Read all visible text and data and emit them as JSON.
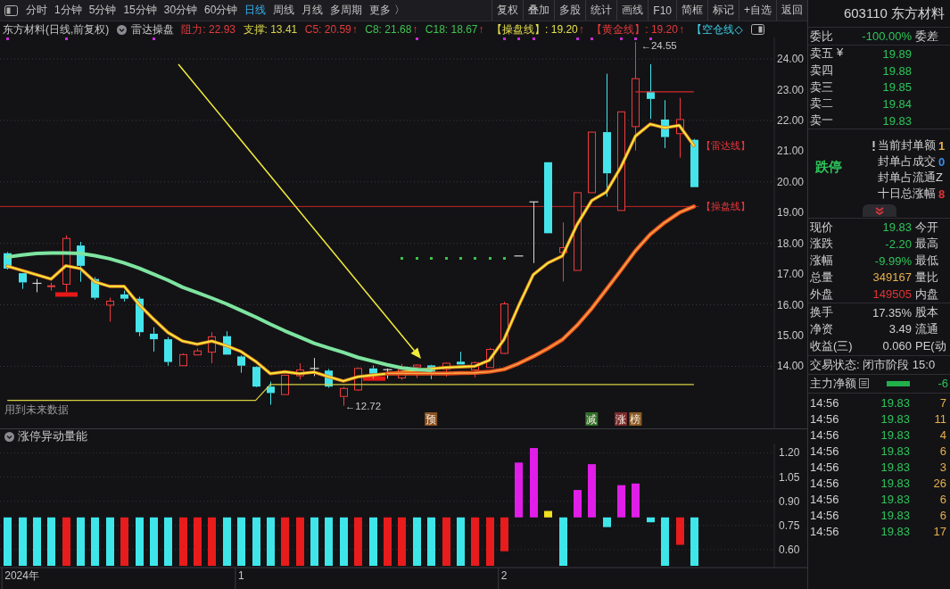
{
  "toolbar": {
    "period_tabs": [
      {
        "label": "分时",
        "selected": false
      },
      {
        "label": "1分钟",
        "selected": false
      },
      {
        "label": "5分钟",
        "selected": false
      },
      {
        "label": "15分钟",
        "selected": false
      },
      {
        "label": "30分钟",
        "selected": false
      },
      {
        "label": "60分钟",
        "selected": false
      },
      {
        "label": "日线",
        "selected": true
      },
      {
        "label": "周线",
        "selected": false
      },
      {
        "label": "月线",
        "selected": false
      },
      {
        "label": "多周期",
        "selected": false
      },
      {
        "label": "更多 〉",
        "selected": false
      }
    ],
    "actions": [
      "复权",
      "叠加",
      "多股",
      "统计",
      "画线",
      "F10",
      "简框",
      "标记",
      "+自选",
      "返回"
    ]
  },
  "indicator_bar": {
    "title": "东方材料(日线,前复权)",
    "indicator": "雷达操盘",
    "values": [
      {
        "label": "阻力: 22.93",
        "color": "#e33b3b"
      },
      {
        "label": "支撑: 13.41",
        "color": "#d9d44a"
      },
      {
        "label": "C5: 20.59",
        "color": "#e33b3b",
        "arrow": "↑"
      },
      {
        "label": "C8: 21.68",
        "color": "#3fc24f",
        "arrow": "↑"
      },
      {
        "label": "C18: 18.67",
        "color": "#3fc24f",
        "arrow": "↑"
      },
      {
        "label": "【操盘线】: 19.20",
        "color": "#e6e04a",
        "arrow": "↑"
      },
      {
        "label": "【黄金线】: 19.20",
        "color": "#e33b3b",
        "arrow": "↑"
      },
      {
        "label": "【空仓线◇",
        "color": "#3ccfe6"
      }
    ]
  },
  "main_chart": {
    "chart_data": {
      "type": "candlestick",
      "categories": [
        null,
        null,
        null,
        null,
        null,
        null,
        null,
        null,
        null,
        null,
        null,
        null,
        null,
        null,
        null,
        null,
        null,
        null,
        null,
        null,
        null,
        null,
        null,
        null,
        null,
        null,
        null,
        null,
        null,
        null,
        null,
        null,
        null,
        null,
        null,
        null,
        null,
        null,
        null,
        null,
        null,
        null,
        null,
        null,
        null,
        null,
        null,
        null
      ],
      "ylim": [
        11.98,
        24.7
      ],
      "yticks": [
        {
          "value": 14,
          "label": "14.00"
        },
        {
          "value": 15,
          "label": "15.00"
        },
        {
          "value": 16,
          "label": "16.00"
        },
        {
          "value": 17,
          "label": "17.00"
        },
        {
          "value": 18,
          "label": "18.00"
        },
        {
          "value": 19,
          "label": "19.00"
        },
        {
          "value": 20,
          "label": "20.00"
        },
        {
          "value": 21,
          "label": "21.00"
        },
        {
          "value": 22,
          "label": "22.00"
        },
        {
          "value": 23,
          "label": "23.00"
        },
        {
          "value": 24,
          "label": "24.00"
        }
      ],
      "grid": true,
      "ohlc": [
        [
          17.68,
          17.72,
          17.15,
          17.18
        ],
        [
          17.03,
          17.03,
          16.52,
          16.73
        ],
        [
          16.7,
          16.84,
          16.41,
          16.7
        ],
        [
          16.6,
          16.72,
          16.46,
          16.62
        ],
        [
          16.67,
          18.26,
          16.41,
          18.16
        ],
        [
          17.93,
          18.05,
          16.75,
          17.27
        ],
        [
          16.84,
          16.9,
          16.17,
          16.23
        ],
        [
          15.99,
          16.23,
          15.45,
          16.12
        ],
        [
          16.34,
          16.46,
          16.11,
          16.2
        ],
        [
          16.2,
          16.26,
          14.98,
          15.11
        ],
        [
          15.06,
          15.27,
          14.48,
          14.88
        ],
        [
          14.88,
          14.95,
          14.02,
          14.14
        ],
        [
          14.02,
          14.42,
          14.02,
          14.38
        ],
        [
          14.37,
          14.58,
          14.37,
          14.5
        ],
        [
          14.46,
          15.11,
          14.1,
          14.96
        ],
        [
          14.98,
          15.14,
          14.38,
          14.38
        ],
        [
          14.32,
          14.36,
          13.79,
          14.02
        ],
        [
          13.98,
          14,
          13.32,
          13.34
        ],
        [
          13.34,
          13.5,
          12.75,
          13.13
        ],
        [
          13.08,
          13.71,
          13.08,
          13.71
        ],
        [
          13.69,
          14.1,
          13.57,
          13.88
        ],
        [
          13.93,
          14.27,
          13.68,
          13.93
        ],
        [
          13.86,
          13.91,
          13.3,
          13.34
        ],
        [
          13.02,
          13.33,
          12.72,
          13.28
        ],
        [
          13.23,
          13.96,
          13.2,
          13.93
        ],
        [
          13.93,
          14.03,
          13.6,
          13.76
        ],
        [
          13.89,
          13.93,
          13.6,
          13.89
        ],
        [
          13.62,
          14.08,
          13.56,
          13.9
        ],
        [
          13.98,
          14.06,
          13.62,
          14.04
        ],
        [
          14.03,
          14.05,
          13.58,
          13.82
        ],
        [
          13.9,
          14.12,
          13.66,
          14.1
        ],
        [
          14.15,
          14.47,
          14.06,
          14.06
        ],
        [
          13.88,
          14.15,
          13.64,
          14.12
        ],
        [
          13.96,
          14.6,
          13.96,
          14.55
        ],
        [
          14.42,
          16.1,
          14.4,
          16.03
        ],
        [
          17.59,
          17.59,
          17.59,
          17.59
        ],
        [
          19.35,
          19.35,
          17.36,
          19.35
        ],
        [
          20.64,
          20.64,
          18.33,
          18.33
        ],
        [
          17.7,
          18.68,
          16.76,
          17.86
        ],
        [
          17.12,
          19.65,
          17.12,
          19.65
        ],
        [
          19.65,
          21.62,
          19.65,
          21.62
        ],
        [
          21.62,
          23.52,
          19.52,
          20.28
        ],
        [
          19.07,
          22.28,
          19.07,
          22.28
        ],
        [
          21.8,
          24.55,
          21.02,
          23.36
        ],
        [
          22.94,
          23.83,
          22.05,
          22.7
        ],
        [
          22.03,
          22.66,
          21.1,
          21.46
        ],
        [
          21.57,
          22.74,
          20.79,
          22.03
        ],
        [
          21.37,
          21.4,
          19.83,
          19.83
        ]
      ],
      "series": [
        {
          "name": "【雷达线】",
          "type": "line",
          "color": "#f4ec3c",
          "values": [
            17.26,
            17.12,
            16.98,
            16.84,
            17.27,
            17.18,
            16.75,
            16.6,
            16.6,
            16.02,
            15.54,
            15.1,
            14.82,
            14.72,
            14.82,
            14.67,
            14.48,
            14.16,
            13.76,
            13.82,
            13.76,
            13.81,
            13.66,
            13.52,
            13.66,
            13.71,
            13.76,
            13.81,
            13.86,
            13.92,
            13.96,
            13.98,
            14,
            14.2,
            14.87,
            15.97,
            16.98,
            17.36,
            17.59,
            18.61,
            19.39,
            19.67,
            20.48,
            21.49,
            21.88,
            21.76,
            21.84,
            21.18
          ]
        },
        {
          "name": "【操盘线】",
          "type": "line",
          "color": "#e8501e",
          "values": [
            null,
            null,
            null,
            null,
            null,
            null,
            null,
            null,
            null,
            null,
            null,
            null,
            null,
            null,
            null,
            null,
            null,
            null,
            null,
            null,
            null,
            null,
            null,
            null,
            null,
            null,
            13.77,
            13.77,
            13.77,
            13.77,
            13.77,
            13.78,
            13.79,
            13.82,
            13.9,
            14.09,
            14.32,
            14.58,
            14.87,
            15.33,
            15.88,
            16.5,
            17.12,
            17.76,
            18.29,
            18.68,
            19,
            19.2
          ]
        },
        {
          "type": "line",
          "color": "#7ee4a0",
          "values": [
            17.56,
            17.62,
            17.67,
            17.69,
            17.69,
            17.67,
            17.6,
            17.5,
            17.36,
            17.2,
            17,
            16.8,
            16.57,
            16.4,
            16.22,
            16.03,
            15.82,
            15.6,
            15.37,
            15.15,
            14.95,
            14.75,
            14.6,
            14.45,
            14.29,
            14.17,
            14.05,
            13.95,
            13.9,
            13.87,
            null,
            null,
            null,
            null,
            null,
            null,
            null,
            null,
            null,
            null,
            null,
            null,
            null,
            null,
            null,
            null,
            null,
            null
          ]
        },
        {
          "type": "line",
          "color": "#d8d040",
          "values": [
            12.89,
            12.89,
            12.89,
            12.89,
            12.89,
            12.89,
            12.89,
            12.89,
            12.89,
            12.89,
            12.89,
            12.89,
            12.89,
            12.89,
            12.89,
            12.89,
            12.89,
            12.89,
            13.41,
            13.41,
            13.41,
            13.41,
            13.41,
            13.41,
            13.41,
            13.41,
            13.41,
            13.41,
            13.41,
            13.41,
            13.41,
            13.41,
            13.41,
            13.41,
            13.41,
            13.41,
            13.41,
            13.41,
            13.41,
            13.41,
            13.41,
            13.41,
            13.41,
            13.41,
            13.41,
            13.41,
            13.41,
            13.41
          ]
        },
        {
          "type": "line",
          "color": "#d42a2a",
          "values": [
            null,
            null,
            null,
            null,
            null,
            null,
            null,
            null,
            null,
            null,
            null,
            null,
            null,
            null,
            null,
            null,
            null,
            null,
            null,
            null,
            null,
            null,
            null,
            null,
            null,
            null,
            null,
            null,
            null,
            null,
            null,
            null,
            null,
            null,
            null,
            null,
            null,
            null,
            null,
            null,
            null,
            null,
            null,
            22.93,
            22.93,
            22.93,
            22.93,
            22.93
          ]
        },
        {
          "type": "scatter",
          "marker": "square",
          "color": "#c42ed4",
          "values": [
            24.66,
            null,
            null,
            null,
            24.66,
            null,
            null,
            null,
            null,
            null,
            24.66,
            null,
            null,
            null,
            null,
            null,
            null,
            null,
            null,
            null,
            null,
            null,
            null,
            null,
            null,
            null,
            null,
            null,
            24.66,
            null,
            null,
            null,
            null,
            null,
            24.66,
            24.66,
            24.66,
            null,
            null,
            24.66,
            24.66,
            null,
            24.66,
            24.66,
            24.66,
            null,
            null,
            null
          ]
        },
        {
          "type": "scatter",
          "marker": "square",
          "color": "#3cc24c",
          "values": [
            null,
            null,
            null,
            null,
            null,
            null,
            null,
            null,
            null,
            null,
            null,
            null,
            null,
            null,
            null,
            null,
            null,
            null,
            null,
            null,
            null,
            null,
            null,
            null,
            null,
            null,
            null,
            17.53,
            17.53,
            17.53,
            17.53,
            17.53,
            17.53,
            17.53,
            17.53,
            null,
            null,
            null,
            null,
            null,
            null,
            null,
            null,
            null,
            null,
            null,
            null,
            null
          ]
        }
      ],
      "ref_lines": [
        {
          "axis": "y",
          "value": 19.2,
          "color": "#c42626"
        }
      ],
      "annotations": [
        "←24.55",
        "←12.72"
      ]
    },
    "notice": "用到未来数据",
    "signals": [
      {
        "label": "预",
        "color": "#8a4f1e"
      },
      {
        "label": "减",
        "color": "#2f6e2a"
      },
      {
        "label": "涨",
        "color": "#7c2a2c"
      },
      {
        "label": "榜",
        "color": "#8a5a24"
      }
    ]
  },
  "sub_chart": {
    "title": "涨停异动量能",
    "chart_data": {
      "type": "bar",
      "categories": [
        null,
        "2024年",
        null,
        null,
        null,
        null,
        null,
        null,
        null,
        null,
        null,
        null,
        null,
        null,
        null,
        null,
        "1",
        null,
        null,
        null,
        null,
        null,
        null,
        null,
        null,
        null,
        null,
        null,
        null,
        null,
        null,
        null,
        null,
        null,
        "2",
        null,
        null,
        null,
        null,
        null,
        null,
        null,
        null,
        null,
        null,
        null,
        null,
        null,
        null,
        null,
        null,
        null,
        null
      ],
      "base": [
        0.8,
        0.8,
        0.8,
        0.8,
        0.8,
        0.8,
        0.8,
        0.8,
        0.8,
        0.8,
        0.8,
        0.8,
        0.8,
        0.8,
        0.8,
        0.8,
        0.8,
        0.8,
        0.8,
        0.8,
        0.8,
        0.8,
        0.8,
        0.8,
        0.8,
        0.8,
        0.8,
        0.8,
        0.8,
        0.8,
        0.8,
        0.8,
        0.8,
        0.8,
        0.8,
        0.8,
        0.8,
        0.8,
        0.8,
        0.8,
        0.8,
        0.8,
        0.8,
        0.8,
        0.8,
        0.8,
        0.8,
        0.8,
        null,
        null,
        null,
        null,
        null
      ],
      "values": [
        -0.3,
        -0.3,
        -0.3,
        -0.3,
        -0.3,
        -0.3,
        -0.3,
        -0.3,
        -0.3,
        -0.3,
        -0.3,
        -0.3,
        -0.3,
        -0.3,
        -0.3,
        -0.3,
        -0.3,
        -0.3,
        -0.3,
        -0.3,
        -0.3,
        -0.3,
        -0.3,
        -0.3,
        -0.3,
        -0.3,
        -0.3,
        -0.3,
        -0.3,
        -0.3,
        -0.3,
        -0.3,
        -0.3,
        -0.3,
        -0.21,
        0.34,
        0.43,
        0.04,
        -0.3,
        0.17,
        0.33,
        -0.06,
        0.2,
        0.21,
        -0.03,
        -0.3,
        -0.17,
        -0.3,
        null,
        null,
        null,
        null,
        null
      ],
      "colors": [
        "#3ee6ea",
        "#3ee6ea",
        "#3ee6ea",
        "#3ee6ea",
        "#e81c1c",
        "#3ee6ea",
        "#3ee6ea",
        "#3ee6ea",
        "#e81c1c",
        "#3ee6ea",
        "#3ee6ea",
        "#3ee6ea",
        "#e81c1c",
        "#e81c1c",
        "#e81c1c",
        "#3ee6ea",
        "#3ee6ea",
        "#3ee6ea",
        "#3ee6ea",
        "#e81c1c",
        "#e81c1c",
        "#3ee6ea",
        "#3ee6ea",
        "#3ee6ea",
        "#e81c1c",
        "#3ee6ea",
        "#e81c1c",
        "#e81c1c",
        "#3ee6ea",
        "#3ee6ea",
        "#e81c1c",
        "#3ee6ea",
        "#e81c1c",
        "#e81c1c",
        "#e81c1c",
        "#e01ee8",
        "#e01ee8",
        "#f0e020",
        "#3ee6ea",
        "#e01ee8",
        "#e01ee8",
        "#3ee6ea",
        "#e01ee8",
        "#e01ee8",
        "#3ee6ea",
        "#3ee6ea",
        "#e81c1c",
        "#3ee6ea",
        null,
        null,
        null,
        null,
        null
      ],
      "ylim": [
        0.5,
        1.258
      ],
      "yticks": [
        {
          "value": 0.6,
          "label": "0.60"
        },
        {
          "value": 0.75,
          "label": "0.75"
        },
        {
          "value": 0.9,
          "label": "0.90"
        },
        {
          "value": 1.05,
          "label": "1.05"
        },
        {
          "value": 1.2,
          "label": "1.20"
        }
      ],
      "grid": true
    }
  },
  "quote_panel": {
    "title": "603110 东方材料",
    "order_ratio": {
      "label": "委比",
      "value": "-100.00%",
      "label2": "委差"
    },
    "asks": [
      {
        "label": "卖五",
        "tag": "¥",
        "price": "19.89"
      },
      {
        "label": "卖四",
        "price": "19.88"
      },
      {
        "label": "卖三",
        "price": "19.85"
      },
      {
        "label": "卖二",
        "price": "19.84"
      },
      {
        "label": "卖一",
        "price": "19.83"
      }
    ],
    "limit": {
      "status": "跌停",
      "metrics": [
        {
          "label": "当前封单额",
          "value": "1",
          "color": "#e8b04c",
          "alert": true
        },
        {
          "label": "封单占成交",
          "value": "0",
          "color": "#3c8ce6",
          "alert": false
        },
        {
          "label": "封单占流通Z",
          "alert": false
        },
        {
          "label": "十日总涨幅",
          "value": "8",
          "color": "#e03434",
          "alert": false
        }
      ]
    },
    "quotes": [
      {
        "label": "现价",
        "value": "19.83",
        "label2": "今开",
        "color": "#2ec45a"
      },
      {
        "label": "涨跌",
        "value": "-2.20",
        "label2": "最高",
        "color": "#2ec45a"
      },
      {
        "label": "涨幅",
        "value": "-9.99%",
        "label2": "最低",
        "color": "#2ec45a"
      },
      {
        "label": "总量",
        "value": "349167",
        "label2": "量比",
        "color": "#e8b04c"
      },
      {
        "label": "外盘",
        "value": "149505",
        "label2": "内盘",
        "color": "#e03434"
      }
    ],
    "fundamentals": [
      {
        "label": "换手",
        "value": "17.35%",
        "label2": "股本"
      },
      {
        "label": "净资",
        "value": "3.49",
        "label2": "流通"
      },
      {
        "label": "收益(三)",
        "value": "0.060",
        "label2": "PE(动"
      }
    ],
    "trade_status": "交易状态: 闭市阶段 15:0",
    "main_flow": {
      "label": "主力净额",
      "value": "-6"
    },
    "ticks": [
      {
        "time": "14:56",
        "price": "19.83",
        "volume": "7"
      },
      {
        "time": "14:56",
        "price": "19.83",
        "volume": "11"
      },
      {
        "time": "14:56",
        "price": "19.83",
        "volume": "4"
      },
      {
        "time": "14:56",
        "price": "19.83",
        "volume": "6"
      },
      {
        "time": "14:56",
        "price": "19.83",
        "volume": "3"
      },
      {
        "time": "14:56",
        "price": "19.83",
        "volume": "26"
      },
      {
        "time": "14:56",
        "price": "19.83",
        "volume": "6"
      },
      {
        "time": "14:56",
        "price": "19.83",
        "volume": "6"
      },
      {
        "time": "14:56",
        "price": "19.83",
        "volume": "17"
      }
    ]
  }
}
